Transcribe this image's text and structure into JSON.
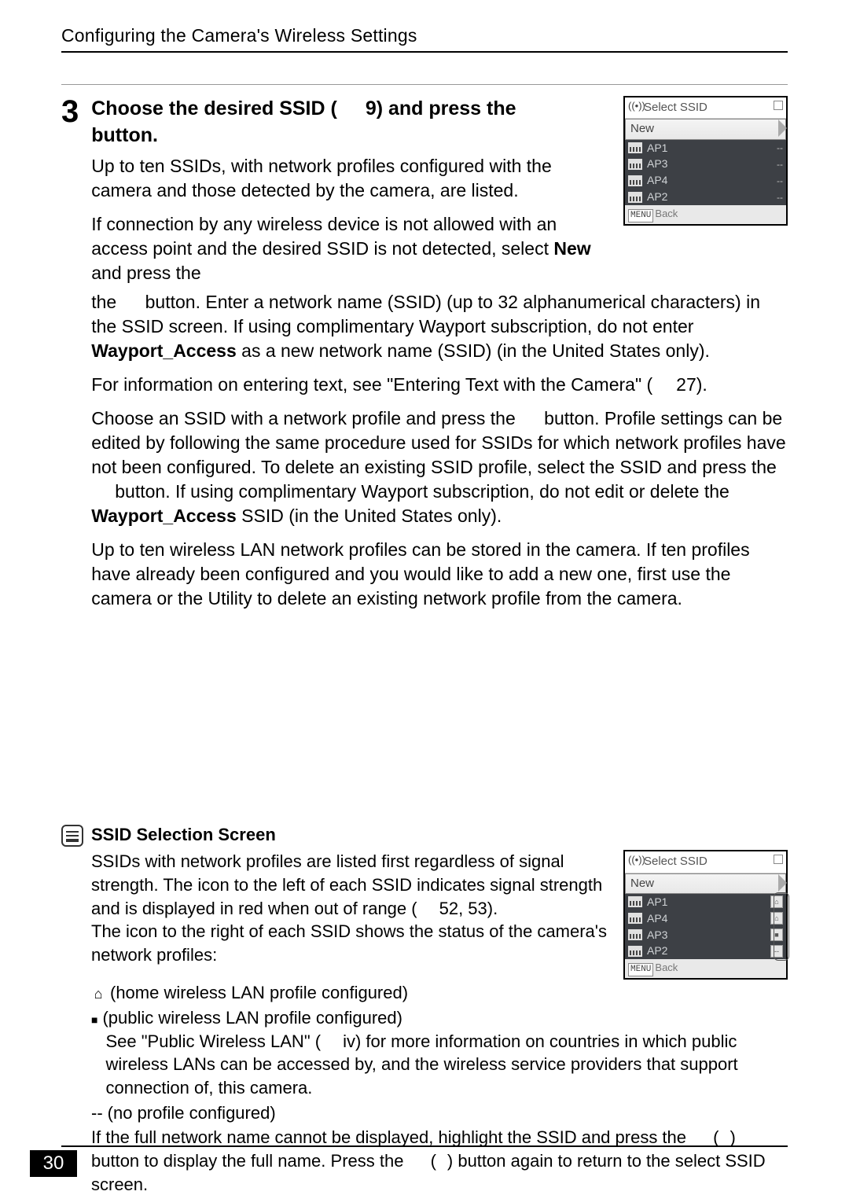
{
  "header": "Configuring the Camera's Wireless Settings",
  "step": {
    "number": "3",
    "title_a": "Choose the desired SSID (",
    "title_b": "9) and press the ",
    "title_c": "button.",
    "p1": "Up to ten SSIDs, with network profiles configured with the camera and those detected by the camera, are listed.",
    "p2a": "If connection by any wireless device is not allowed with an access point and the desired SSID is not detected, select ",
    "p2b": "New",
    "p2c": " and press the ",
    "p2d": "button. Enter a network name (SSID) (up to 32 alphanumerical characters) in the SSID screen. If using complimentary Wayport subscription, do not enter ",
    "p2e": "Wayport_Access",
    "p2f": " as a new network name (SSID) (in the United States only).",
    "p3a": "For information on entering text, see \"Entering Text with the Camera\" (",
    "p3b": "27).",
    "p4a": "Choose an SSID with a network profile and press the ",
    "p4b": "button. Profile settings can be edited by following the same procedure used for SSIDs for which network profiles have not been configured. To delete an existing SSID profile, select the SSID and press the ",
    "p4c": "button. If using complimentary Wayport subscription, do not edit or delete the ",
    "p4d": "Wayport_Access",
    "p4e": " SSID (in the United States only).",
    "p5": "Up to ten wireless LAN network profiles can be stored in the camera. If ten profiles have already been configured and you would like to add a new one, first use the camera or the Utility to delete an existing network profile from the camera."
  },
  "note": {
    "title": "SSID Selection Screen",
    "p1a": "SSIDs with network profiles are listed first regardless of signal strength. The icon to the left of each SSID indicates signal strength and is displayed in red when out of range (",
    "p1b": "52, 53).",
    "p2": "The icon to the right of each SSID shows the status of the camera's network profiles:",
    "b1": "(home wireless LAN profile configured)",
    "b2": "(public wireless LAN profile configured)",
    "b2sub_a": "See \"Public Wireless LAN\" (",
    "b2sub_b": "iv) for more information on countries in which public wireless LANs can be accessed by, and the wireless service providers that support connection of, this camera.",
    "b3pre": "--",
    "b3": "(no profile configured)",
    "p3a": "If the full network name cannot be displayed, highlight the SSID and press the ",
    "p3b": "(",
    "p3c": ") button to display the full name. Press the ",
    "p3d": "(",
    "p3e": ") button again to return to the select SSID screen."
  },
  "camera1": {
    "title": "Select SSID",
    "new": "New",
    "rows": [
      "AP1",
      "AP3",
      "AP4",
      "AP2"
    ],
    "foot": "Back"
  },
  "camera2": {
    "title": "Select SSID",
    "new": "New",
    "rows": [
      "AP1",
      "AP4",
      "AP3",
      "AP2"
    ],
    "foot": "Back"
  },
  "page_number": "30"
}
